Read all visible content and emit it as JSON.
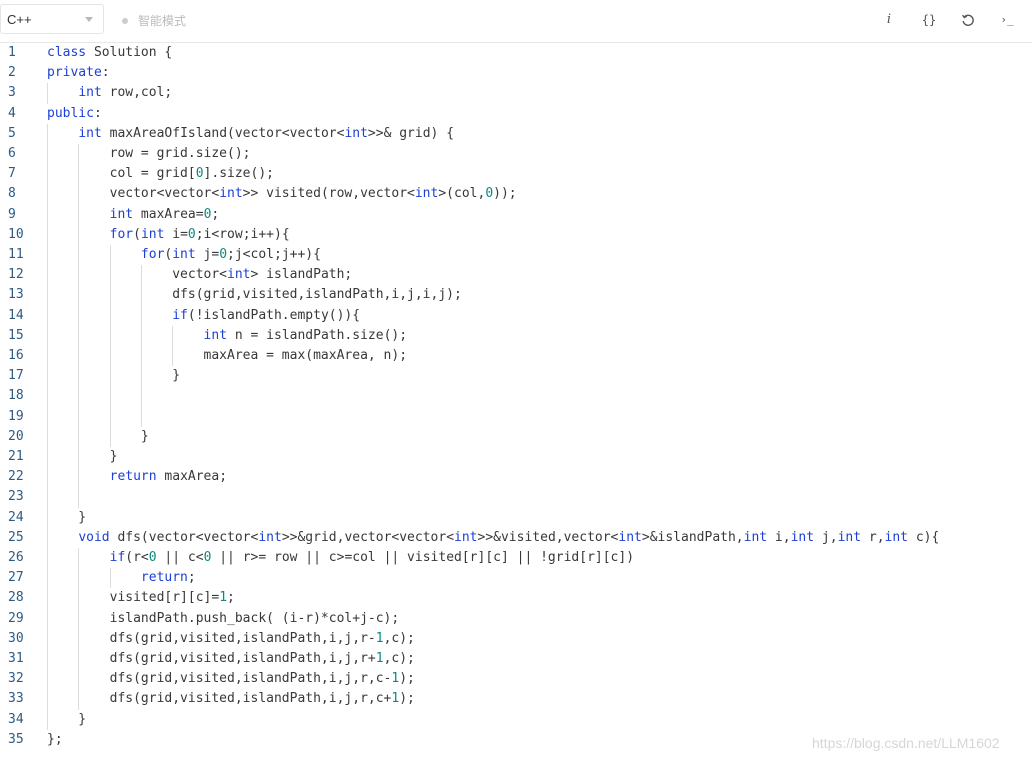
{
  "toolbar": {
    "language": "C++",
    "smart_mode_label": "智能模式",
    "info_icon_glyph": "i",
    "braces_icon_glyph": "{}",
    "terminal_icon_glyph": "›_"
  },
  "editor": {
    "line_numbers": [
      "1",
      "2",
      "3",
      "4",
      "5",
      "6",
      "7",
      "8",
      "9",
      "10",
      "11",
      "12",
      "13",
      "14",
      "15",
      "16",
      "17",
      "18",
      "19",
      "20",
      "21",
      "22",
      "23",
      "24",
      "25",
      "26",
      "27",
      "28",
      "29",
      "30",
      "31",
      "32",
      "33",
      "34",
      "35"
    ],
    "lines": [
      [
        [
          "kw",
          "class"
        ],
        [
          "t",
          " Solution {"
        ]
      ],
      [
        [
          "kw",
          "private"
        ],
        [
          "t",
          ":"
        ]
      ],
      [
        [
          "t",
          "    "
        ],
        [
          "kw",
          "int"
        ],
        [
          "t",
          " row,col;"
        ]
      ],
      [
        [
          "kw",
          "public"
        ],
        [
          "t",
          ":"
        ]
      ],
      [
        [
          "t",
          "    "
        ],
        [
          "kw",
          "int"
        ],
        [
          "t",
          " maxAreaOfIsland(vector<vector<"
        ],
        [
          "kw",
          "int"
        ],
        [
          "t",
          ">>& grid) {"
        ]
      ],
      [
        [
          "t",
          "        row = grid.size();"
        ]
      ],
      [
        [
          "t",
          "        col = grid["
        ],
        [
          "num",
          "0"
        ],
        [
          "t",
          "].size();"
        ]
      ],
      [
        [
          "t",
          "        vector<vector<"
        ],
        [
          "kw",
          "int"
        ],
        [
          "t",
          ">> visited(row,vector<"
        ],
        [
          "kw",
          "int"
        ],
        [
          "t",
          ">(col,"
        ],
        [
          "num",
          "0"
        ],
        [
          "t",
          "));"
        ]
      ],
      [
        [
          "t",
          "        "
        ],
        [
          "kw",
          "int"
        ],
        [
          "t",
          " maxArea="
        ],
        [
          "num",
          "0"
        ],
        [
          "t",
          ";"
        ]
      ],
      [
        [
          "t",
          "        "
        ],
        [
          "kw",
          "for"
        ],
        [
          "t",
          "("
        ],
        [
          "kw",
          "int"
        ],
        [
          "t",
          " i="
        ],
        [
          "num",
          "0"
        ],
        [
          "t",
          ";i<row;i++){"
        ]
      ],
      [
        [
          "t",
          "            "
        ],
        [
          "kw",
          "for"
        ],
        [
          "t",
          "("
        ],
        [
          "kw",
          "int"
        ],
        [
          "t",
          " j="
        ],
        [
          "num",
          "0"
        ],
        [
          "t",
          ";j<col;j++){"
        ]
      ],
      [
        [
          "t",
          "                vector<"
        ],
        [
          "kw",
          "int"
        ],
        [
          "t",
          "> islandPath;"
        ]
      ],
      [
        [
          "t",
          "                dfs(grid,visited,islandPath,i,j,i,j);"
        ]
      ],
      [
        [
          "t",
          "                "
        ],
        [
          "kw",
          "if"
        ],
        [
          "t",
          "(!islandPath.empty()){"
        ]
      ],
      [
        [
          "t",
          "                    "
        ],
        [
          "kw",
          "int"
        ],
        [
          "t",
          " n = islandPath.size();"
        ]
      ],
      [
        [
          "t",
          "                    maxArea = max(maxArea, n);"
        ]
      ],
      [
        [
          "t",
          "                }"
        ]
      ],
      [],
      [],
      [
        [
          "t",
          "            }"
        ]
      ],
      [
        [
          "t",
          "        }"
        ]
      ],
      [
        [
          "t",
          "        "
        ],
        [
          "kw",
          "return"
        ],
        [
          "t",
          " maxArea;"
        ]
      ],
      [],
      [
        [
          "t",
          "    }"
        ]
      ],
      [
        [
          "t",
          "    "
        ],
        [
          "kw",
          "void"
        ],
        [
          "t",
          " dfs(vector<vector<"
        ],
        [
          "kw",
          "int"
        ],
        [
          "t",
          ">>&grid,vector<vector<"
        ],
        [
          "kw",
          "int"
        ],
        [
          "t",
          ">>&visited,vector<"
        ],
        [
          "kw",
          "int"
        ],
        [
          "t",
          ">&islandPath,"
        ],
        [
          "kw",
          "int"
        ],
        [
          "t",
          " i,"
        ],
        [
          "kw",
          "int"
        ],
        [
          "t",
          " j,"
        ],
        [
          "kw",
          "int"
        ],
        [
          "t",
          " r,"
        ],
        [
          "kw",
          "int"
        ],
        [
          "t",
          " c){"
        ]
      ],
      [
        [
          "t",
          "        "
        ],
        [
          "kw",
          "if"
        ],
        [
          "t",
          "(r<"
        ],
        [
          "num",
          "0"
        ],
        [
          "t",
          " || c<"
        ],
        [
          "num",
          "0"
        ],
        [
          "t",
          " || r>= row || c>=col || visited[r][c] || !grid[r][c])"
        ]
      ],
      [
        [
          "t",
          "            "
        ],
        [
          "kw",
          "return"
        ],
        [
          "t",
          ";"
        ]
      ],
      [
        [
          "t",
          "        visited[r][c]="
        ],
        [
          "num",
          "1"
        ],
        [
          "t",
          ";"
        ]
      ],
      [
        [
          "t",
          "        islandPath.push_back( (i-r)*col+j-c);"
        ]
      ],
      [
        [
          "t",
          "        dfs(grid,visited,islandPath,i,j,r-"
        ],
        [
          "num",
          "1"
        ],
        [
          "t",
          ",c);"
        ]
      ],
      [
        [
          "t",
          "        dfs(grid,visited,islandPath,i,j,r+"
        ],
        [
          "num",
          "1"
        ],
        [
          "t",
          ",c);"
        ]
      ],
      [
        [
          "t",
          "        dfs(grid,visited,islandPath,i,j,r,c-"
        ],
        [
          "num",
          "1"
        ],
        [
          "t",
          ");"
        ]
      ],
      [
        [
          "t",
          "        dfs(grid,visited,islandPath,i,j,r,c+"
        ],
        [
          "num",
          "1"
        ],
        [
          "t",
          ");"
        ]
      ],
      [
        [
          "t",
          "    }"
        ]
      ],
      [
        [
          "t",
          "};"
        ]
      ]
    ]
  },
  "watermark": "https://blog.csdn.net/LLM1602"
}
